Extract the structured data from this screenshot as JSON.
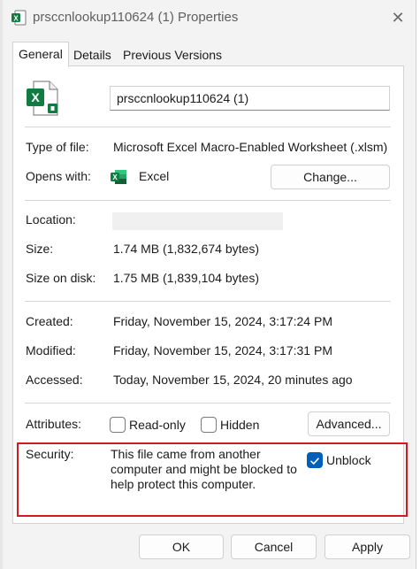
{
  "window": {
    "title": "prsccnlookup110624 (1) Properties",
    "close_glyph": "✕"
  },
  "tabs": [
    {
      "label": "General",
      "active": true
    },
    {
      "label": "Details",
      "active": false
    },
    {
      "label": "Previous Versions",
      "active": false
    }
  ],
  "file": {
    "name": "prsccnlookup110624 (1)",
    "icon": "excel-macro-file-icon"
  },
  "info": {
    "type_label": "Type of file:",
    "type_value": "Microsoft Excel Macro-Enabled Worksheet (.xlsm)",
    "opens_label": "Opens with:",
    "opens_value": "Excel",
    "change_button": "Change...",
    "location_label": "Location:",
    "location_value": "",
    "size_label": "Size:",
    "size_value": "1.74 MB (1,832,674 bytes)",
    "size_disk_label": "Size on disk:",
    "size_disk_value": "1.75 MB (1,839,104 bytes)",
    "created_label": "Created:",
    "created_value": "Friday, November 15, 2024, 3:17:24 PM",
    "modified_label": "Modified:",
    "modified_value": "Friday, November 15, 2024, 3:17:31 PM",
    "accessed_label": "Accessed:",
    "accessed_value": "Today, November 15, 2024, 20 minutes ago"
  },
  "attributes": {
    "label": "Attributes:",
    "readonly_label": "Read-only",
    "readonly_checked": false,
    "hidden_label": "Hidden",
    "hidden_checked": false,
    "advanced_button": "Advanced..."
  },
  "security": {
    "label": "Security:",
    "line1": "This file came from another",
    "line2": "computer and might be blocked to",
    "line3": "help protect this computer.",
    "unblock_label": "Unblock",
    "unblock_checked": true
  },
  "footer": {
    "ok": "OK",
    "cancel": "Cancel",
    "apply": "Apply"
  },
  "colors": {
    "accent": "#005fb8",
    "excel_green": "#107c41",
    "highlight_red": "#d21c1c"
  }
}
